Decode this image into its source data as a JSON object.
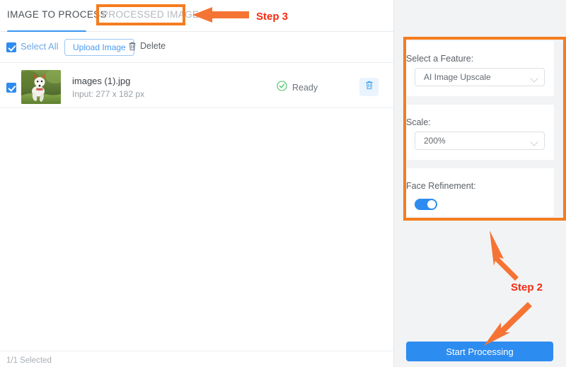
{
  "tabs": [
    {
      "label": "IMAGE TO PROCESS",
      "active": true
    },
    {
      "label": "PROCESSED IMAGE",
      "active": false
    }
  ],
  "toolbar": {
    "select_all_label": "Select All",
    "upload_label": "Upload Image",
    "delete_label": "Delete",
    "select_all_checked": true
  },
  "file_list": {
    "columns": [
      "name",
      "input",
      "status"
    ],
    "rows": [
      {
        "checked": true,
        "name": "images (1).jpg",
        "input": "Input: 277 x 182 px",
        "status": "Ready",
        "thumbnail_alt": "jack-russell-terrier-running-on-grass"
      }
    ]
  },
  "footer": {
    "selection_count": "1/1 Selected"
  },
  "settings_panel": {
    "feature": {
      "label": "Select a Feature:",
      "value": "AI Image Upscale"
    },
    "scale": {
      "label": "Scale:",
      "value": "200%"
    },
    "face_refinement": {
      "label": "Face Refinement:",
      "value": "on"
    },
    "start_button_label": "Start Processing"
  },
  "annotations": {
    "step3_label": "Step 3",
    "step2_label": "Step 2",
    "highlight_color": "#f57c1f",
    "label_color": "#f42a10",
    "arrow_color": "#f57434"
  },
  "colors": {
    "accent_blue": "#2d8cf0",
    "tab_active_underline": "#3897f0",
    "status_green": "#3fc25b",
    "panel_bg": "#f2f3f5",
    "body_bg": "#ffffff"
  }
}
